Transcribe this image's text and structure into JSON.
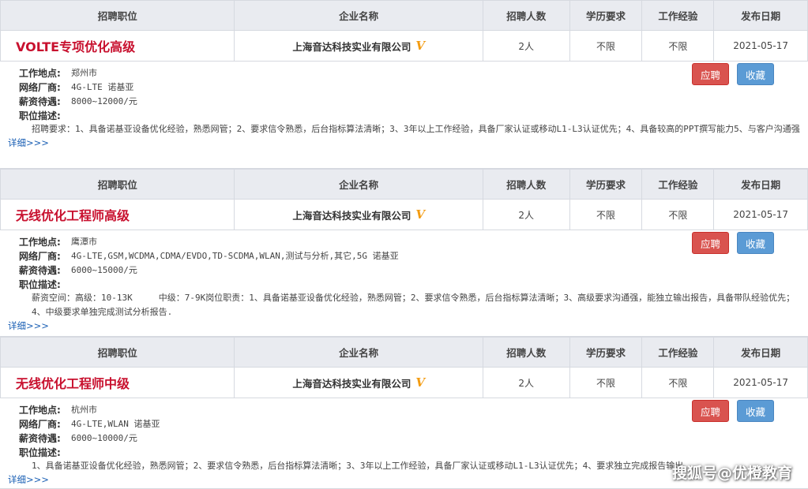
{
  "headers": {
    "position": "招聘职位",
    "company": "企业名称",
    "count": "招聘人数",
    "education": "学历要求",
    "experience": "工作经验",
    "date": "发布日期"
  },
  "labels": {
    "location": "工作地点:",
    "vendor": "网络厂商:",
    "salary": "薪资待遇:",
    "description": "职位描述:",
    "more": "详细>>>",
    "apply": "应聘",
    "favorite": "收藏",
    "verified_badge": "V"
  },
  "jobs": [
    {
      "title": "VOLTE专项优化高级",
      "company": "上海音达科技实业有限公司",
      "count": "2人",
      "education": "不限",
      "experience": "不限",
      "date": "2021-05-17",
      "location": "郑州市",
      "vendor": "4G-LTE 诺基亚",
      "salary": "8000~12000/元",
      "description": "招聘要求：1、具备诺基亚设备优化经验，熟悉网管；2、要求信令熟悉，后台指标算法清晰；3、3年以上工作经验，具备厂家认证或移动L1-L3认证优先；4、具备较高的PPT撰写能力5、与客户沟通强"
    },
    {
      "title": "无线优化工程师高级",
      "company": "上海音达科技实业有限公司",
      "count": "2人",
      "education": "不限",
      "experience": "不限",
      "date": "2021-05-17",
      "location": "鹰潭市",
      "vendor": "4G-LTE,GSM,WCDMA,CDMA/EVDO,TD-SCDMA,WLAN,测试与分析,其它,5G 诺基亚",
      "salary": "6000~15000/元",
      "description": "薪资空间：高级：10-13K　　　中级：7-9K岗位职责：1、具备诺基亚设备优化经验，熟悉网管；2、要求信令熟悉，后台指标算法清晰；3、高级要求沟通强，能独立输出报告，具备带队经验优先；4、中级要求单独完成测试分析报告."
    },
    {
      "title": "无线优化工程师中级",
      "company": "上海音达科技实业有限公司",
      "count": "2人",
      "education": "不限",
      "experience": "不限",
      "date": "2021-05-17",
      "location": "杭州市",
      "vendor": "4G-LTE,WLAN 诺基亚",
      "salary": "6000~10000/元",
      "description": "1、具备诺基亚设备优化经验，熟悉网管；2、要求信令熟悉，后台指标算法清晰；3、3年以上工作经验，具备厂家认证或移动L1-L3认证优先；4、要求独立完成报告输出"
    }
  ],
  "watermark": "搜狐号@优橙教育"
}
